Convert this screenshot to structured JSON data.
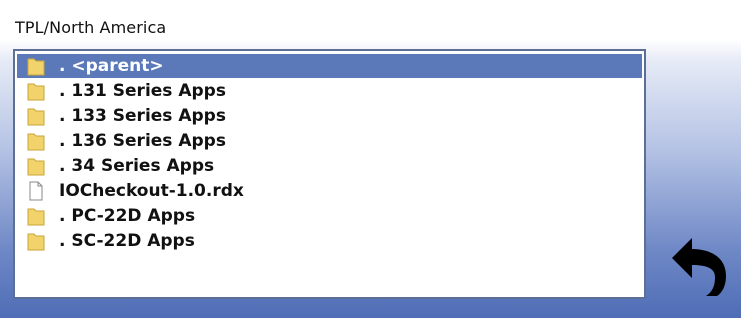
{
  "path": "TPL/North America",
  "items": [
    {
      "label": ". <parent>",
      "icon": "folder-icon",
      "selected": true
    },
    {
      "label": ". 131 Series Apps",
      "icon": "folder-icon"
    },
    {
      "label": ". 133 Series Apps",
      "icon": "folder-icon"
    },
    {
      "label": ". 136 Series Apps",
      "icon": "folder-icon"
    },
    {
      "label": ". 34 Series Apps",
      "icon": "folder-icon"
    },
    {
      "label": "IOCheckout-1.0.rdx",
      "icon": "file-icon"
    },
    {
      "label": ". PC-22D Apps",
      "icon": "folder-icon"
    },
    {
      "label": ". SC-22D Apps",
      "icon": "folder-icon"
    }
  ],
  "back_button": {
    "icon": "back-arrow-icon"
  },
  "colors": {
    "selection": "#5b78b9",
    "folder": "#f2d36b",
    "border": "#5d6f95"
  }
}
